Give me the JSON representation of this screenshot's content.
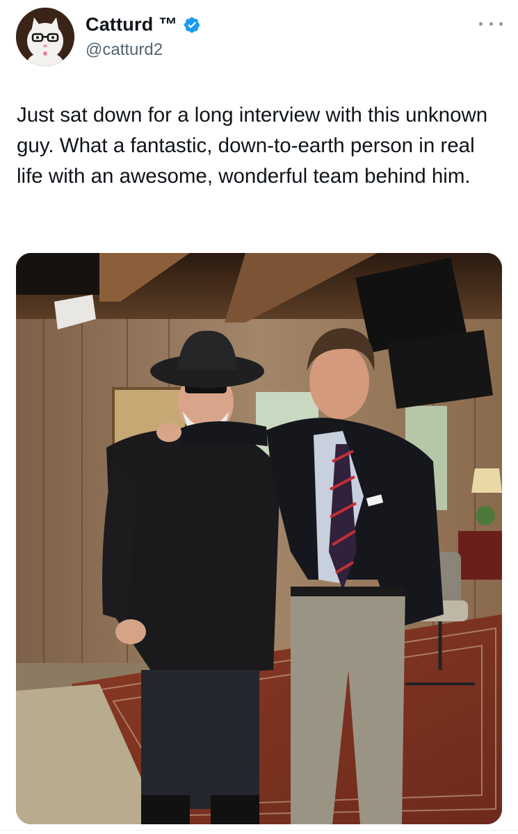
{
  "author": {
    "display_name": "Catturd ™",
    "handle": "@catturd2",
    "verified": true,
    "avatar_icon": "white-cat-with-glasses-avatar"
  },
  "tweet": {
    "text": "Just sat down for a long interview with this unknown guy. What a fantastic, down-to-earth person in real life with an awesome, wonderful team behind him."
  },
  "media": {
    "type": "photo"
  },
  "colors": {
    "verified_blue": "#1d9bf0",
    "secondary_text": "#536471",
    "primary_text": "#0f1419"
  },
  "icons": {
    "more": "more-horizontal-icon",
    "verified": "verified-badge-icon"
  }
}
